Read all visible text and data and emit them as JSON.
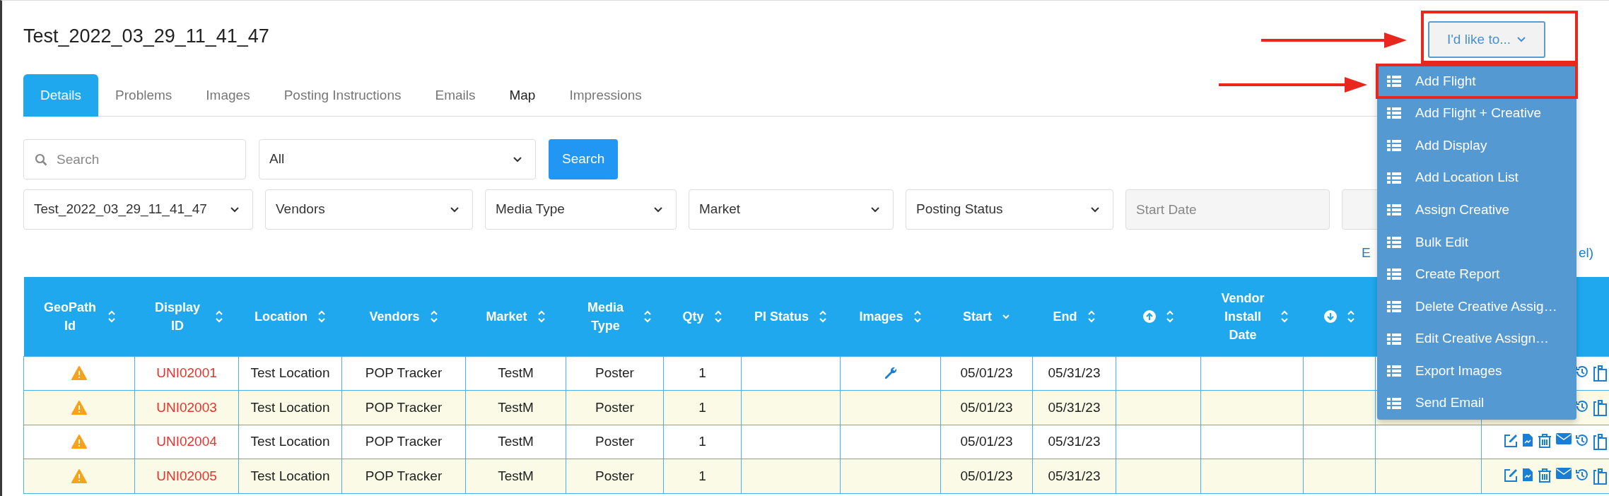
{
  "page_title": "Test_2022_03_29_11_41_47",
  "action_menu": {
    "label": "I'd like to...",
    "highlighted": true,
    "expanded": true,
    "items": [
      {
        "label": "Add Flight",
        "highlighted": true
      },
      {
        "label": "Add Flight + Creative",
        "highlighted": false
      },
      {
        "label": "Add Display",
        "highlighted": false
      },
      {
        "label": "Add Location List",
        "highlighted": false
      },
      {
        "label": "Assign Creative",
        "highlighted": false
      },
      {
        "label": "Bulk Edit",
        "highlighted": false
      },
      {
        "label": "Create Report",
        "highlighted": false
      },
      {
        "label": "Delete Creative Assig…",
        "highlighted": false
      },
      {
        "label": "Edit Creative Assign…",
        "highlighted": false
      },
      {
        "label": "Export Images",
        "highlighted": false
      },
      {
        "label": "Send Email",
        "highlighted": false
      }
    ]
  },
  "tabs": [
    {
      "label": "Details",
      "selected": true,
      "hovered": false
    },
    {
      "label": "Problems",
      "selected": false,
      "hovered": false
    },
    {
      "label": "Images",
      "selected": false,
      "hovered": false
    },
    {
      "label": "Posting Instructions",
      "selected": false,
      "hovered": false
    },
    {
      "label": "Emails",
      "selected": false,
      "hovered": false
    },
    {
      "label": "Map",
      "selected": false,
      "hovered": true
    },
    {
      "label": "Impressions",
      "selected": false,
      "hovered": false
    }
  ],
  "search_bar": {
    "placeholder": "Search",
    "scope": "All",
    "button": "Search"
  },
  "filters": [
    {
      "kind": "select",
      "value": "Test_2022_03_29_11_41_47"
    },
    {
      "kind": "select",
      "value": "Vendors"
    },
    {
      "kind": "select",
      "value": "Media Type"
    },
    {
      "kind": "select",
      "value": "Market"
    },
    {
      "kind": "select",
      "value": "Posting Status"
    },
    {
      "kind": "date",
      "placeholder": "Start Date"
    },
    {
      "kind": "date"
    }
  ],
  "link_fragments": [
    "E",
    "el)"
  ],
  "table": {
    "columns": [
      {
        "kind": "text",
        "label": "GeoPath Id",
        "sorted": false
      },
      {
        "kind": "text",
        "label": "Display ID",
        "sorted": false
      },
      {
        "kind": "text",
        "label": "Location",
        "sorted": false
      },
      {
        "kind": "text",
        "label": "Vendors",
        "sorted": false
      },
      {
        "kind": "text",
        "label": "Market",
        "sorted": false
      },
      {
        "kind": "text",
        "label": "Media Type",
        "sorted": false
      },
      {
        "kind": "text",
        "label": "Qty",
        "sorted": false
      },
      {
        "kind": "text",
        "label": "PI Status",
        "sorted": false
      },
      {
        "kind": "text",
        "label": "Images",
        "sorted": false
      },
      {
        "kind": "text",
        "label": "Start",
        "sorted": true
      },
      {
        "kind": "text",
        "label": "End",
        "sorted": false
      },
      {
        "kind": "icon-up",
        "sorted": false
      },
      {
        "kind": "text",
        "label": "Vendor Install Date",
        "sorted": false
      },
      {
        "kind": "icon-down",
        "sorted": false
      },
      {
        "kind": "blank"
      },
      {
        "kind": "blank"
      }
    ],
    "rows": [
      {
        "geopath_warning": true,
        "display_id": "UNI02001",
        "location": "Test Location",
        "vendors": "POP Tracker",
        "market": "TestM",
        "media_type": "Poster",
        "qty": "1",
        "images_tool": true,
        "start": "05/01/23",
        "end": "05/31/23"
      },
      {
        "geopath_warning": true,
        "display_id": "UNI02003",
        "location": "Test Location",
        "vendors": "POP Tracker",
        "market": "TestM",
        "media_type": "Poster",
        "qty": "1",
        "images_tool": false,
        "start": "05/01/23",
        "end": "05/31/23"
      },
      {
        "geopath_warning": true,
        "display_id": "UNI02004",
        "location": "Test Location",
        "vendors": "POP Tracker",
        "market": "TestM",
        "media_type": "Poster",
        "qty": "1",
        "images_tool": false,
        "start": "05/01/23",
        "end": "05/31/23"
      },
      {
        "geopath_warning": true,
        "display_id": "UNI02005",
        "location": "Test Location",
        "vendors": "POP Tracker",
        "market": "TestM",
        "media_type": "Poster",
        "qty": "1",
        "images_tool": false,
        "start": "05/01/23",
        "end": "05/31/23"
      }
    ]
  }
}
